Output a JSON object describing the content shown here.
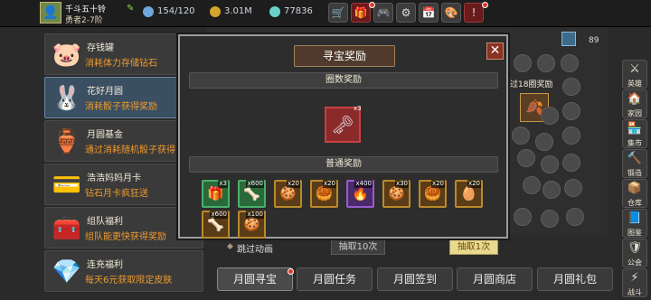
{
  "topbar": {
    "player_name": "千斗五十铃",
    "player_level": "勇者2-7阶",
    "energy": "154/120",
    "gold": "3.01M",
    "gems": "77836",
    "icons": [
      "shop-icon",
      "gift-icon",
      "gamepad-icon",
      "gear-icon",
      "calendar-icon",
      "palette-icon",
      "notice-icon"
    ]
  },
  "left_menu": [
    {
      "title": "存钱罐",
      "desc": "消耗体力存储钻石",
      "icon": "piggy-bank-icon",
      "glyph": "🐷"
    },
    {
      "title": "花好月圆",
      "desc": "消耗骰子获得奖励",
      "icon": "moon-rabbit-icon",
      "glyph": "🐰",
      "selected": true
    },
    {
      "title": "月圆基金",
      "desc": "通过消耗随机骰子获得",
      "icon": "fund-pot-icon",
      "glyph": "🏺"
    },
    {
      "title": "浩浩妈妈月卡",
      "desc": "钻石月卡疯狂送",
      "icon": "month-card-icon",
      "glyph": "💳"
    },
    {
      "title": "组队福利",
      "desc": "组队能更快获得奖励",
      "icon": "team-chest-icon",
      "glyph": "🧰"
    },
    {
      "title": "连充福利",
      "desc": "每天6元获取限定皮肤",
      "icon": "crystal-icon",
      "glyph": "💎"
    }
  ],
  "background": {
    "banner": "过18圈奖励",
    "count": "89",
    "skip_label": "跳过动画",
    "draw10_label": "抽取10次",
    "draw1_label": "抽取1次"
  },
  "bottom_tabs": [
    "月圆寻宝",
    "月圆任务",
    "月圆签到",
    "月圆商店",
    "月圆礼包"
  ],
  "right_column": [
    {
      "label": "英雄",
      "glyph": "⚔"
    },
    {
      "label": "家园",
      "glyph": "🏠"
    },
    {
      "label": "集市",
      "glyph": "🏪"
    },
    {
      "label": "锻造",
      "glyph": "🔨"
    },
    {
      "label": "仓库",
      "glyph": "📦"
    },
    {
      "label": "图鉴",
      "glyph": "📘"
    },
    {
      "label": "公会",
      "glyph": "🛡"
    },
    {
      "label": "战斗",
      "glyph": "⚡"
    }
  ],
  "modal": {
    "title": "寻宝奖励",
    "section_round": "圈数奖励",
    "section_normal": "普通奖励",
    "round_item": {
      "icon": "keys-icon",
      "qty": "x3"
    },
    "normal_items": [
      {
        "icon": "chest-icon",
        "qty": "x3",
        "tier": "green",
        "glyph": "🎁"
      },
      {
        "icon": "bone-icon",
        "qty": "x600",
        "tier": "green",
        "glyph": "🦴"
      },
      {
        "icon": "biscuit-icon",
        "qty": "x20",
        "tier": "gold",
        "glyph": "🍪"
      },
      {
        "icon": "mooncake-icon",
        "qty": "x20",
        "tier": "gold",
        "glyph": "🥮"
      },
      {
        "icon": "fire-ring-icon",
        "qty": "x400",
        "tier": "purple",
        "glyph": "🔥"
      },
      {
        "icon": "cookie-icon",
        "qty": "x30",
        "tier": "gold",
        "glyph": "🍪"
      },
      {
        "icon": "mooncake2-icon",
        "qty": "x20",
        "tier": "gold",
        "glyph": "🥮"
      },
      {
        "icon": "golden-egg-icon",
        "qty": "x20",
        "tier": "gold",
        "glyph": "🥚"
      },
      {
        "icon": "bone2-icon",
        "qty": "x600",
        "tier": "gold",
        "glyph": "🦴"
      },
      {
        "icon": "pastry-icon",
        "qty": "x100",
        "tier": "gold",
        "glyph": "🍪"
      }
    ]
  }
}
